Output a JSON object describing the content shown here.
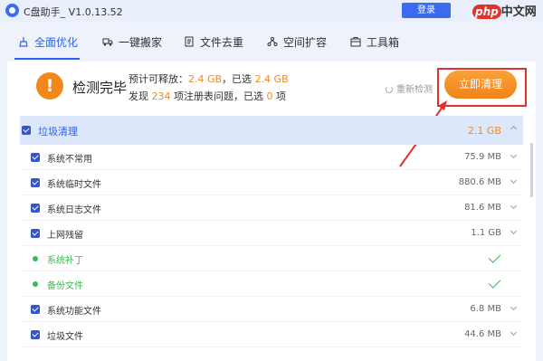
{
  "titlebar": {
    "title": "C盘助手_ V1.0.13.52",
    "login_label": "登录",
    "watermark_php": "php",
    "watermark_text": "中文网"
  },
  "tabs": [
    {
      "label": "全面优化",
      "icon": "broom-icon",
      "active": true
    },
    {
      "label": "一键搬家",
      "icon": "truck-icon",
      "active": false
    },
    {
      "label": "文件去重",
      "icon": "document-icon",
      "active": false
    },
    {
      "label": "空间扩容",
      "icon": "expand-icon",
      "active": false
    },
    {
      "label": "工具箱",
      "icon": "toolbox-icon",
      "active": false
    }
  ],
  "summary": {
    "status": "检测完毕",
    "line1": {
      "prefix": "预计可释放：",
      "free": "2.4 GB",
      "mid": "，已选",
      "selected": "2.4 GB"
    },
    "line2": {
      "prefix": "发现",
      "count": "234",
      "mid": "项注册表问题，已选",
      "selected_count": "0",
      "suffix": "项"
    },
    "rescan_label": "重新检测",
    "clean_label": "立即清理"
  },
  "list": {
    "header": {
      "label": "垃圾清理",
      "size": "2.1 GB"
    },
    "rows": [
      {
        "label": "系统不常用",
        "size": "75.9 MB",
        "kind": "checkbox"
      },
      {
        "label": "系统临时文件",
        "size": "880.6 MB",
        "kind": "checkbox"
      },
      {
        "label": "系统日志文件",
        "size": "81.6 MB",
        "kind": "checkbox"
      },
      {
        "label": "上网残留",
        "size": "1.1 GB",
        "kind": "checkbox"
      },
      {
        "label": "系统补丁",
        "size": "",
        "kind": "dot"
      },
      {
        "label": "备份文件",
        "size": "",
        "kind": "dot"
      },
      {
        "label": "系统功能文件",
        "size": "6.8 MB",
        "kind": "checkbox"
      },
      {
        "label": "垃圾文件",
        "size": "44.6 MB",
        "kind": "checkbox"
      }
    ]
  },
  "colors": {
    "accent": "#2c61ee",
    "orange": "#f08a1f",
    "green": "#3cb755",
    "highlight": "#e23030"
  }
}
